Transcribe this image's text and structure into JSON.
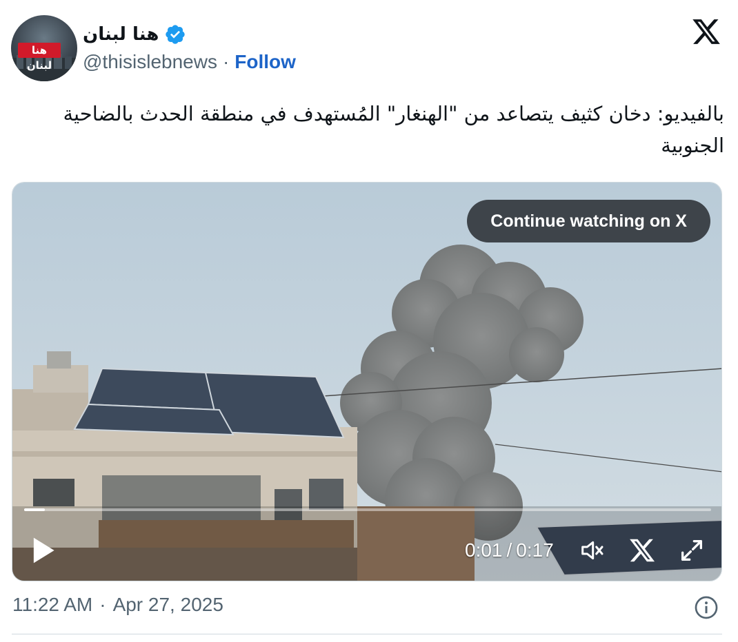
{
  "author": {
    "display_name": "هنا لبنان",
    "handle": "@thisislebnews",
    "separator": "·",
    "follow_label": "Follow",
    "avatar_logo_text": "هنا لبنان"
  },
  "icons": {
    "verified": "verified-badge-icon",
    "brand": "x-logo-icon",
    "play": "play-icon",
    "volume": "volume-muted-icon",
    "expand": "fullscreen-icon",
    "info": "info-icon"
  },
  "tweet": {
    "text": "بالفيديو: دخان كثيف يتصاعد من \"الهنغار\" المُستهدف في منطقة الحدث بالضاحية الجنوبية"
  },
  "video": {
    "continue_label": "Continue watching on X",
    "current_time": "0:01",
    "time_separator": "/",
    "duration": "0:17",
    "progress": 0.03
  },
  "footer": {
    "time": "11:22 AM",
    "separator": "·",
    "date": "Apr 27, 2025"
  },
  "colors": {
    "link": "#1d64c8",
    "verified": "#1d9bf0",
    "muted_text": "#536471"
  }
}
